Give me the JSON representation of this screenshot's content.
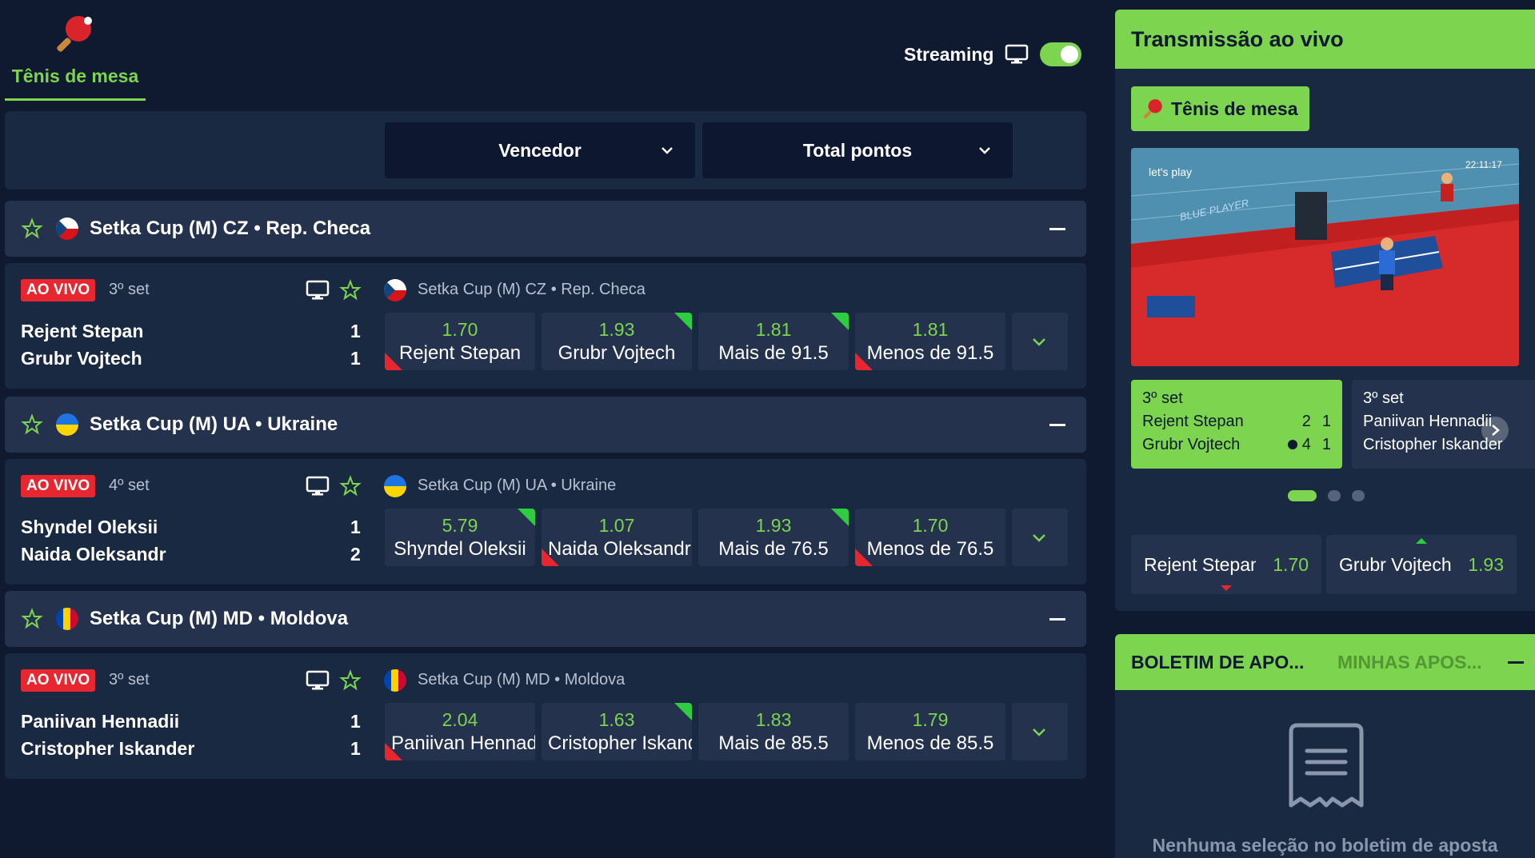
{
  "sport_tab": {
    "label": "Tênis de mesa",
    "icon": "ping-pong-paddle-icon"
  },
  "streaming": {
    "label": "Streaming",
    "enabled": true
  },
  "filters": {
    "market1": "Vencedor",
    "market2": "Total pontos"
  },
  "colors": {
    "accent": "#7dd44e",
    "live_badge": "#e8262f",
    "background": "#0f1930",
    "panel": "#1a2942"
  },
  "leagues": [
    {
      "title": "Setka Cup (M) CZ • Rep. Checa",
      "flag": "czech-flag",
      "match": {
        "badge": "AO VIVO",
        "set": "3º set",
        "league": "Setka Cup (M) CZ • Rep. Checa",
        "player1": "Rejent Stepan",
        "player2": "Grubr Vojtech",
        "score1": "1",
        "score2": "1",
        "odds": [
          {
            "value": "1.70",
            "name": "Rejent Stepan",
            "trend": "down"
          },
          {
            "value": "1.93",
            "name": "Grubr Vojtech",
            "trend": "up"
          },
          {
            "value": "1.81",
            "name": "Mais de 91.5",
            "trend": "up"
          },
          {
            "value": "1.81",
            "name": "Menos de 91.5",
            "trend": "down"
          }
        ]
      }
    },
    {
      "title": "Setka Cup (M) UA • Ukraine",
      "flag": "ukraine-flag",
      "match": {
        "badge": "AO VIVO",
        "set": "4º set",
        "league": "Setka Cup (M) UA • Ukraine",
        "player1": "Shyndel Oleksii",
        "player2": "Naida Oleksandr",
        "score1": "1",
        "score2": "2",
        "odds": [
          {
            "value": "5.79",
            "name": "Shyndel Oleksii",
            "trend": "up"
          },
          {
            "value": "1.07",
            "name": "Naida Oleksandr",
            "trend": "down"
          },
          {
            "value": "1.93",
            "name": "Mais de 76.5",
            "trend": "up"
          },
          {
            "value": "1.70",
            "name": "Menos de 76.5",
            "trend": "down"
          }
        ]
      }
    },
    {
      "title": "Setka Cup (M) MD • Moldova",
      "flag": "moldova-flag",
      "match": {
        "badge": "AO VIVO",
        "set": "3º set",
        "league": "Setka Cup (M) MD • Moldova",
        "player1": "Paniivan Hennadii",
        "player2": "Cristopher Iskander",
        "score1": "1",
        "score2": "1",
        "odds": [
          {
            "value": "2.04",
            "name": "Paniivan Hennadii",
            "trend": "down"
          },
          {
            "value": "1.63",
            "name": "Cristopher Iskander",
            "trend": "up"
          },
          {
            "value": "1.83",
            "name": "Mais de 85.5",
            "trend": "none"
          },
          {
            "value": "1.79",
            "name": "Menos de 85.5",
            "trend": "none"
          }
        ]
      }
    }
  ],
  "live": {
    "title": "Transmissão ao vivo",
    "chip": "Tênis de mesa",
    "video": {
      "caption": "let's play",
      "time": "22:11:17",
      "label": "BLUE PLAYER"
    },
    "cards": [
      {
        "set": "3º set",
        "p1": "Rejent Stepan",
        "p2": "Grubr Vojtech",
        "p1_sets": "2",
        "p1_pts": "1",
        "p2_sets": "4",
        "p2_pts": "1"
      },
      {
        "set": "3º set",
        "p1": "Paniivan Hennadii",
        "p2": "Cristopher Iskander"
      }
    ],
    "quick_odds": [
      {
        "name": "Rejent Stepan",
        "value": "1.70"
      },
      {
        "name": "Grubr Vojtech",
        "value": "1.93"
      }
    ]
  },
  "betslip": {
    "tab1": "BOLETIM DE APO...",
    "tab2": "MINHAS APOS...",
    "empty": "Nenhuma seleção no boletim de aposta"
  }
}
